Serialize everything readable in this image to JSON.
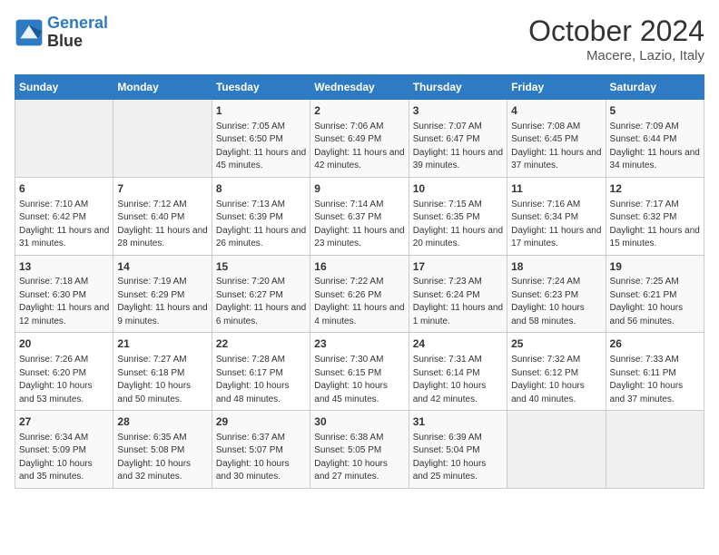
{
  "header": {
    "logo_line1": "General",
    "logo_line2": "Blue",
    "month": "October 2024",
    "location": "Macere, Lazio, Italy"
  },
  "days_of_week": [
    "Sunday",
    "Monday",
    "Tuesday",
    "Wednesday",
    "Thursday",
    "Friday",
    "Saturday"
  ],
  "weeks": [
    [
      {
        "day": "",
        "info": ""
      },
      {
        "day": "",
        "info": ""
      },
      {
        "day": "1",
        "info": "Sunrise: 7:05 AM\nSunset: 6:50 PM\nDaylight: 11 hours and 45 minutes."
      },
      {
        "day": "2",
        "info": "Sunrise: 7:06 AM\nSunset: 6:49 PM\nDaylight: 11 hours and 42 minutes."
      },
      {
        "day": "3",
        "info": "Sunrise: 7:07 AM\nSunset: 6:47 PM\nDaylight: 11 hours and 39 minutes."
      },
      {
        "day": "4",
        "info": "Sunrise: 7:08 AM\nSunset: 6:45 PM\nDaylight: 11 hours and 37 minutes."
      },
      {
        "day": "5",
        "info": "Sunrise: 7:09 AM\nSunset: 6:44 PM\nDaylight: 11 hours and 34 minutes."
      }
    ],
    [
      {
        "day": "6",
        "info": "Sunrise: 7:10 AM\nSunset: 6:42 PM\nDaylight: 11 hours and 31 minutes."
      },
      {
        "day": "7",
        "info": "Sunrise: 7:12 AM\nSunset: 6:40 PM\nDaylight: 11 hours and 28 minutes."
      },
      {
        "day": "8",
        "info": "Sunrise: 7:13 AM\nSunset: 6:39 PM\nDaylight: 11 hours and 26 minutes."
      },
      {
        "day": "9",
        "info": "Sunrise: 7:14 AM\nSunset: 6:37 PM\nDaylight: 11 hours and 23 minutes."
      },
      {
        "day": "10",
        "info": "Sunrise: 7:15 AM\nSunset: 6:35 PM\nDaylight: 11 hours and 20 minutes."
      },
      {
        "day": "11",
        "info": "Sunrise: 7:16 AM\nSunset: 6:34 PM\nDaylight: 11 hours and 17 minutes."
      },
      {
        "day": "12",
        "info": "Sunrise: 7:17 AM\nSunset: 6:32 PM\nDaylight: 11 hours and 15 minutes."
      }
    ],
    [
      {
        "day": "13",
        "info": "Sunrise: 7:18 AM\nSunset: 6:30 PM\nDaylight: 11 hours and 12 minutes."
      },
      {
        "day": "14",
        "info": "Sunrise: 7:19 AM\nSunset: 6:29 PM\nDaylight: 11 hours and 9 minutes."
      },
      {
        "day": "15",
        "info": "Sunrise: 7:20 AM\nSunset: 6:27 PM\nDaylight: 11 hours and 6 minutes."
      },
      {
        "day": "16",
        "info": "Sunrise: 7:22 AM\nSunset: 6:26 PM\nDaylight: 11 hours and 4 minutes."
      },
      {
        "day": "17",
        "info": "Sunrise: 7:23 AM\nSunset: 6:24 PM\nDaylight: 11 hours and 1 minute."
      },
      {
        "day": "18",
        "info": "Sunrise: 7:24 AM\nSunset: 6:23 PM\nDaylight: 10 hours and 58 minutes."
      },
      {
        "day": "19",
        "info": "Sunrise: 7:25 AM\nSunset: 6:21 PM\nDaylight: 10 hours and 56 minutes."
      }
    ],
    [
      {
        "day": "20",
        "info": "Sunrise: 7:26 AM\nSunset: 6:20 PM\nDaylight: 10 hours and 53 minutes."
      },
      {
        "day": "21",
        "info": "Sunrise: 7:27 AM\nSunset: 6:18 PM\nDaylight: 10 hours and 50 minutes."
      },
      {
        "day": "22",
        "info": "Sunrise: 7:28 AM\nSunset: 6:17 PM\nDaylight: 10 hours and 48 minutes."
      },
      {
        "day": "23",
        "info": "Sunrise: 7:30 AM\nSunset: 6:15 PM\nDaylight: 10 hours and 45 minutes."
      },
      {
        "day": "24",
        "info": "Sunrise: 7:31 AM\nSunset: 6:14 PM\nDaylight: 10 hours and 42 minutes."
      },
      {
        "day": "25",
        "info": "Sunrise: 7:32 AM\nSunset: 6:12 PM\nDaylight: 10 hours and 40 minutes."
      },
      {
        "day": "26",
        "info": "Sunrise: 7:33 AM\nSunset: 6:11 PM\nDaylight: 10 hours and 37 minutes."
      }
    ],
    [
      {
        "day": "27",
        "info": "Sunrise: 6:34 AM\nSunset: 5:09 PM\nDaylight: 10 hours and 35 minutes."
      },
      {
        "day": "28",
        "info": "Sunrise: 6:35 AM\nSunset: 5:08 PM\nDaylight: 10 hours and 32 minutes."
      },
      {
        "day": "29",
        "info": "Sunrise: 6:37 AM\nSunset: 5:07 PM\nDaylight: 10 hours and 30 minutes."
      },
      {
        "day": "30",
        "info": "Sunrise: 6:38 AM\nSunset: 5:05 PM\nDaylight: 10 hours and 27 minutes."
      },
      {
        "day": "31",
        "info": "Sunrise: 6:39 AM\nSunset: 5:04 PM\nDaylight: 10 hours and 25 minutes."
      },
      {
        "day": "",
        "info": ""
      },
      {
        "day": "",
        "info": ""
      }
    ]
  ]
}
